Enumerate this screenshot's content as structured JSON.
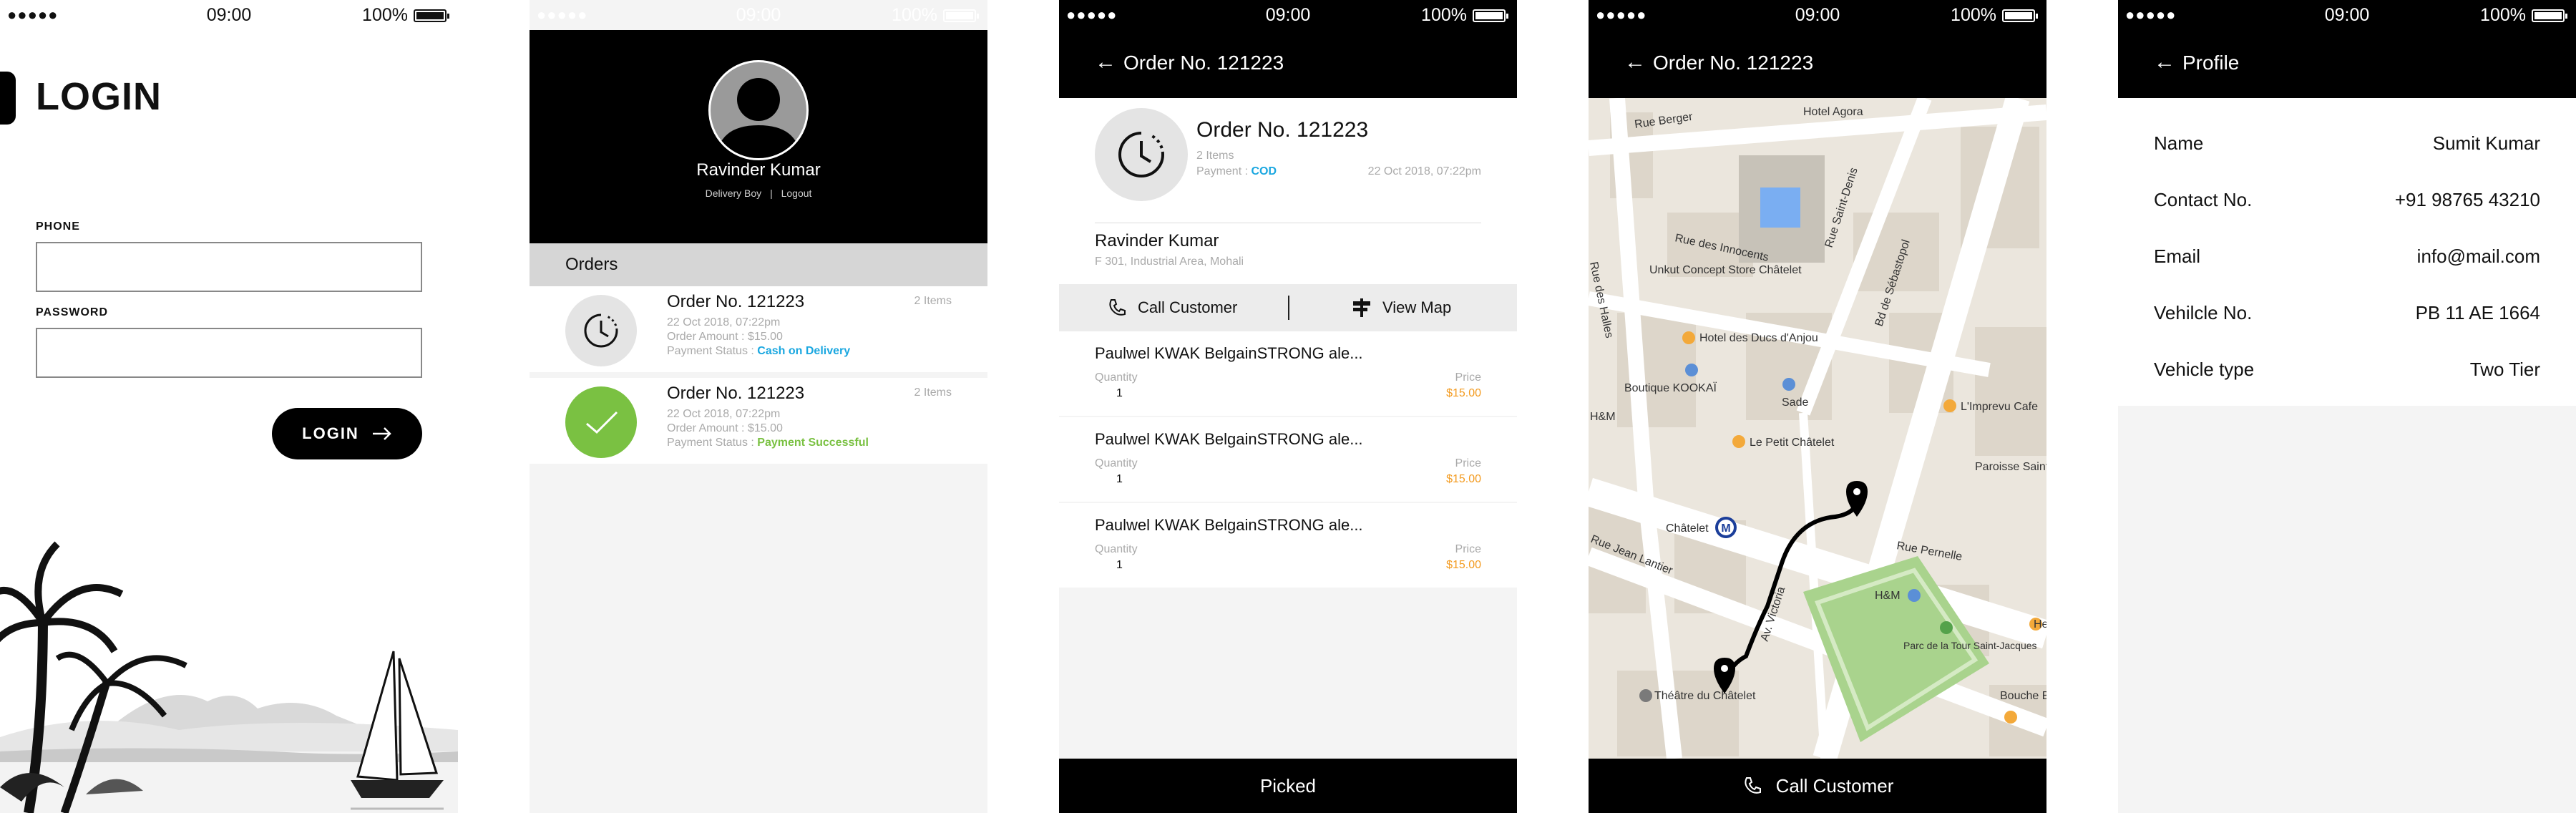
{
  "status": {
    "time": "09:00",
    "battery": "100%",
    "signal": "●●●●●"
  },
  "login": {
    "title": "LOGIN",
    "phone_label": "PHONE",
    "password_label": "PASSWORD",
    "button": "LOGIN"
  },
  "drawer": {
    "name": "Ravinder Kumar",
    "role": "Delivery Boy",
    "separator": "|",
    "logout": "Logout",
    "orders_heading": "Orders",
    "orders": [
      {
        "title": "Order No. 121223",
        "items": "2 Items",
        "date": "22 Oct 2018, 07:22pm",
        "amount": "Order Amount : $15.00",
        "status_label": "Payment Status :",
        "status_value": "Cash on Delivery"
      },
      {
        "title": "Order No. 121223",
        "items": "2 Items",
        "date": "22 Oct 2018, 07:22pm",
        "amount": "Order Amount : $15.00",
        "status_label": "Payment Status :",
        "status_value": "Payment Successful"
      }
    ]
  },
  "order_detail": {
    "header": "Order No. 121223",
    "title": "Order No. 121223",
    "items": "2 Items",
    "payment_label": "Payment :",
    "payment_value": "COD",
    "date": "22 Oct 2018, 07:22pm",
    "customer": "Ravinder Kumar",
    "address": "F 301, Industrial Area, Mohali",
    "call": "Call Customer",
    "map": "View Map",
    "products": [
      {
        "name": "Paulwel KWAK BelgainSTRONG ale...",
        "qty_label": "Quantity",
        "qty": "1",
        "price_label": "Price",
        "price": "$15.00"
      },
      {
        "name": "Paulwel KWAK BelgainSTRONG ale...",
        "qty_label": "Quantity",
        "qty": "1",
        "price_label": "Price",
        "price": "$15.00"
      },
      {
        "name": "Paulwel KWAK BelgainSTRONG ale...",
        "qty_label": "Quantity",
        "qty": "1",
        "price_label": "Price",
        "price": "$15.00"
      }
    ],
    "bottom": "Picked"
  },
  "map_screen": {
    "header": "Order No. 121223",
    "bottom": "Call Customer",
    "labels": [
      "Rue Berger",
      "Hotel Agora",
      "Rue des Innocents",
      "Rue Saint-Denis",
      "Bd de Sébastopol",
      "Unkut Concept Store Châtelet",
      "Rue des Halles",
      "Hotel des Ducs d'Anjou",
      "Boutique KOOKAÏ",
      "Sade",
      "L'Imprevu Cafe",
      "H&M",
      "Le Petit Châtelet",
      "Paroisse Saint M",
      "Châtelet",
      "Rue Pernelle",
      "Rue Jean Lantier",
      "Av. Victoria",
      "H&M",
      "Parc de la Tour Saint-Jacques",
      "He",
      "Théâtre du Châtelet",
      "Bouche B",
      "Bd de Sébastopol"
    ]
  },
  "profile": {
    "header": "Profile",
    "rows": [
      {
        "label": "Name",
        "value": "Sumit Kumar"
      },
      {
        "label": "Contact No.",
        "value": "+91 98765 43210"
      },
      {
        "label": "Email",
        "value": "info@mail.com"
      },
      {
        "label": "Vehilcle No.",
        "value": "PB 11 AE 1664"
      },
      {
        "label": "Vehicle type",
        "value": "Two Tier"
      }
    ]
  },
  "colors": {
    "accent_blue": "#1aa7e0",
    "accent_green": "#7ac142",
    "price_orange": "#f39a1e",
    "header_black": "#000000"
  },
  "icons": [
    "back-arrow-icon",
    "phone-icon",
    "signpost-icon",
    "clock-icon",
    "check-icon",
    "map-pin-icon",
    "metro-icon"
  ]
}
